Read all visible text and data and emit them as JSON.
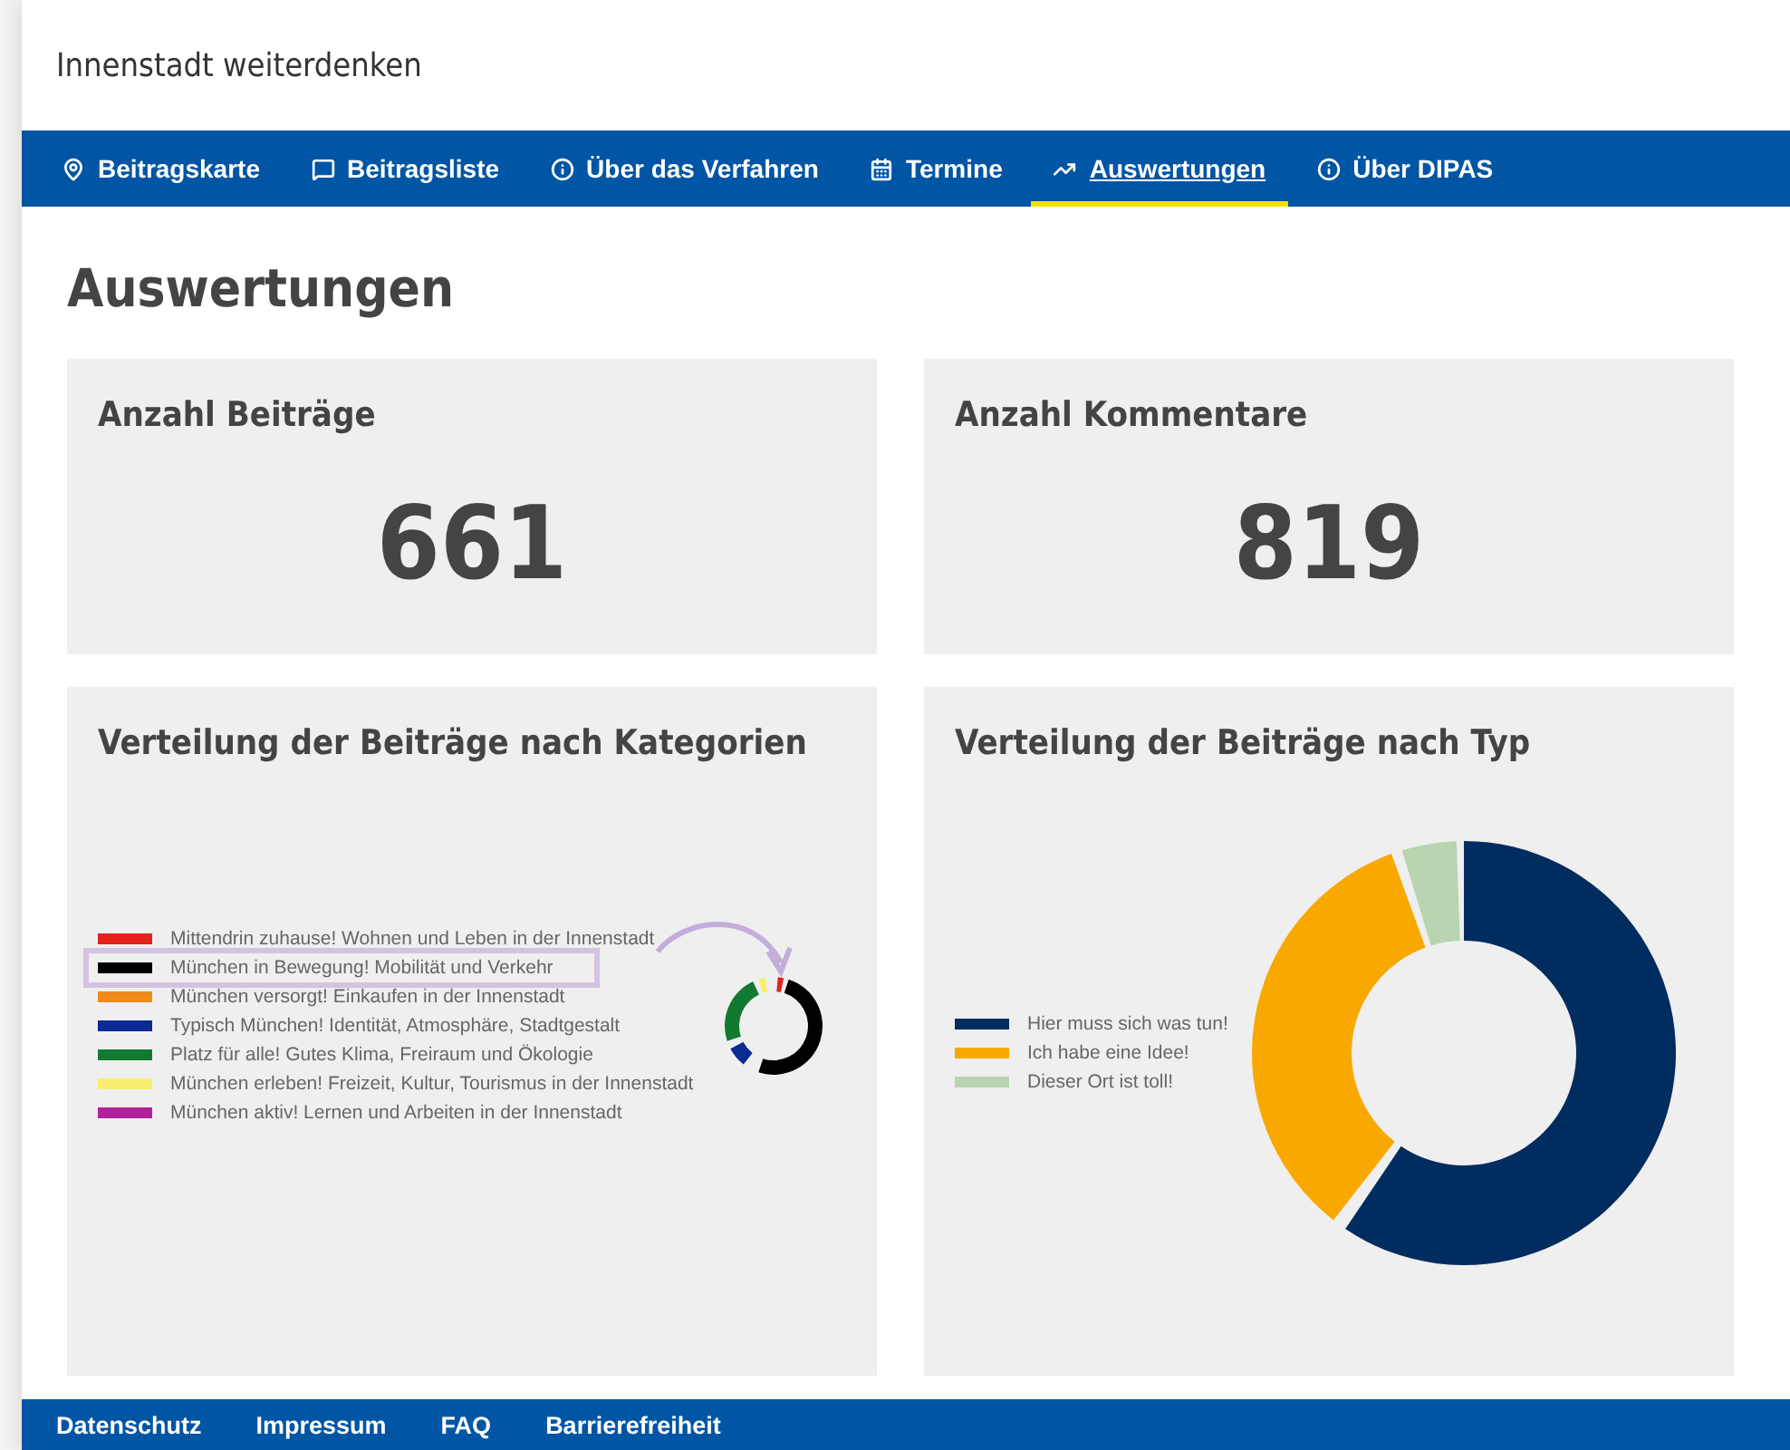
{
  "header": {
    "title": "Innenstadt weiterdenken"
  },
  "nav": [
    {
      "label": "Beitragskarte",
      "selected": false
    },
    {
      "label": "Beitragsliste",
      "selected": false
    },
    {
      "label": "Über das Verfahren",
      "selected": false
    },
    {
      "label": "Termine",
      "selected": false
    },
    {
      "label": "Auswertungen",
      "selected": true
    },
    {
      "label": "Über DIPAS",
      "selected": false
    }
  ],
  "page_title": "Auswertungen",
  "stats": [
    {
      "title": "Anzahl Beiträge",
      "value": "661"
    },
    {
      "title": "Anzahl Kommentare",
      "value": "819"
    }
  ],
  "charts": [
    {
      "title": "Verteilung der Beiträge nach Kategorien",
      "legend": [
        {
          "label": "Mittendrin zuhause! Wohnen und Leben in der Innenstadt",
          "color": "#e3221c",
          "highlighted": false
        },
        {
          "label": "München in Bewegung! Mobilität und Verkehr",
          "color": "#000000",
          "highlighted": true
        },
        {
          "label": "München versorgt! Einkaufen in der Innenstadt",
          "color": "#f08a1c",
          "highlighted": false
        },
        {
          "label": "Typisch München! Identität, Atmosphäre, Stadtgestalt",
          "color": "#0a2a94",
          "highlighted": false
        },
        {
          "label": "Platz für alle! Gutes Klima, Freiraum und Ökologie",
          "color": "#127a30",
          "highlighted": false
        },
        {
          "label": "München erleben! Freizeit, Kultur, Tourismus in der Innenstadt",
          "color": "#f8ee6e",
          "highlighted": false
        },
        {
          "label": "München aktiv! Lernen und Arbeiten in der Innenstadt",
          "color": "#b0229a",
          "highlighted": false
        }
      ]
    },
    {
      "title": "Verteilung der Beiträge nach Typ",
      "legend": [
        {
          "label": "Hier muss sich was tun!",
          "color": "#002c5f"
        },
        {
          "label": "Ich habe eine Idee!",
          "color": "#f9a800"
        },
        {
          "label": "Dieser Ort ist toll!",
          "color": "#b9d4b0"
        }
      ]
    }
  ],
  "footer": [
    {
      "label": "Datenschutz"
    },
    {
      "label": "Impressum"
    },
    {
      "label": "FAQ"
    },
    {
      "label": "Barrierefreiheit"
    }
  ]
}
